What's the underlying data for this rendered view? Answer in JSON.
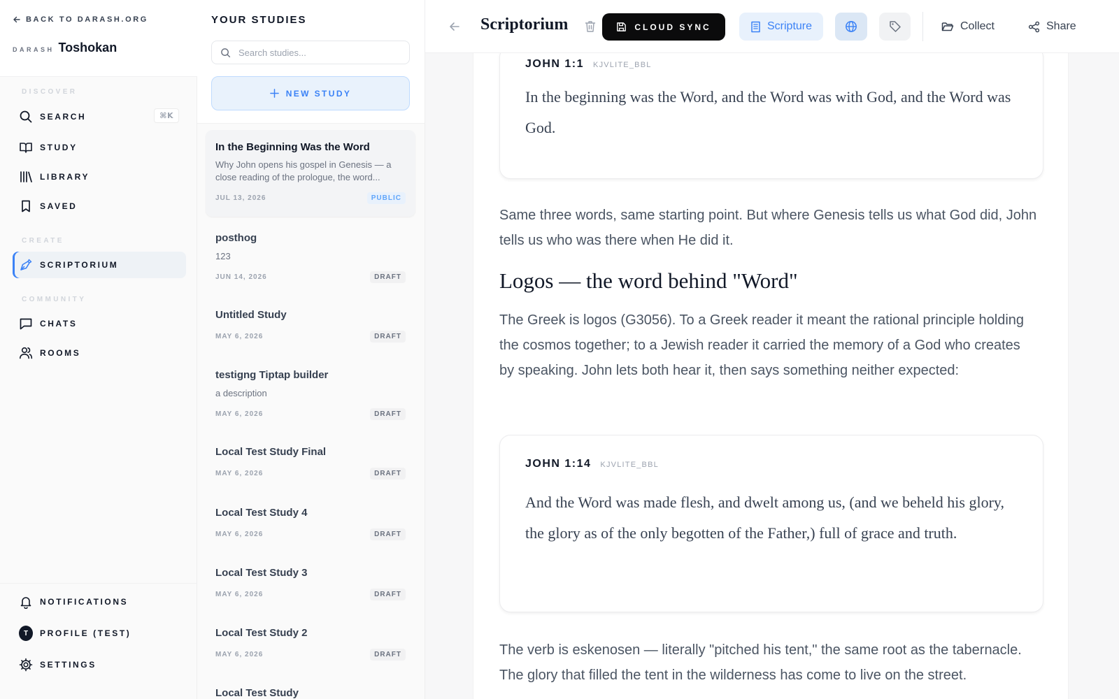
{
  "sidebar": {
    "back_label": "BACK TO DARASH.ORG",
    "brand_prefix": "DARASH",
    "brand_name": "Toshokan",
    "sections": {
      "discover": "DISCOVER",
      "create": "CREATE",
      "community": "COMMUNITY"
    },
    "items": {
      "search": "SEARCH",
      "search_shortcut": "⌘K",
      "study": "STUDY",
      "library": "LIBRARY",
      "saved": "SAVED",
      "scriptorium": "SCRIPTORIUM",
      "chats": "CHATS",
      "rooms": "ROOMS",
      "notifications": "NOTIFICATIONS",
      "profile": "PROFILE (TEST)",
      "profile_initial": "T",
      "settings": "SETTINGS"
    },
    "active_item": "scriptorium"
  },
  "studies": {
    "title": "YOUR STUDIES",
    "search_placeholder": "Search studies...",
    "new_study_label": "NEW STUDY",
    "items": [
      {
        "title": "In the Beginning Was the Word",
        "desc": "Why John opens his gospel in Genesis — a close reading of the prologue, the word...",
        "date": "JUL 13, 2026",
        "status": "PUBLIC"
      },
      {
        "title": "posthog",
        "desc": "123",
        "date": "JUN 14, 2026",
        "status": "DRAFT"
      },
      {
        "title": "Untitled Study",
        "desc": "",
        "date": "MAY 6, 2026",
        "status": "DRAFT"
      },
      {
        "title": "testigng Tiptap builder",
        "desc": "a description",
        "date": "MAY 6, 2026",
        "status": "DRAFT"
      },
      {
        "title": "Local Test Study Final",
        "desc": "",
        "date": "MAY 6, 2026",
        "status": "DRAFT"
      },
      {
        "title": "Local Test Study 4",
        "desc": "",
        "date": "MAY 6, 2026",
        "status": "DRAFT"
      },
      {
        "title": "Local Test Study 3",
        "desc": "",
        "date": "MAY 6, 2026",
        "status": "DRAFT"
      },
      {
        "title": "Local Test Study 2",
        "desc": "",
        "date": "MAY 6, 2026",
        "status": "DRAFT"
      },
      {
        "title": "Local Test Study",
        "desc": "",
        "date": "",
        "status": ""
      }
    ]
  },
  "toolbar": {
    "doc_title": "Scriptorium",
    "cloud_sync_label": "CLOUD SYNC",
    "scripture_label": "Scripture",
    "collect_label": "Collect",
    "share_label": "Share"
  },
  "content": {
    "verse1": {
      "ref": "JOHN 1:1",
      "translation": "KJVLITE_BBL",
      "text": "In the beginning was the Word, and the Word was with God, and the Word was God."
    },
    "para1": "Same three words, same starting point. But where Genesis tells us what God did, John tells us who was there when He did it.",
    "heading1": "Logos — the word behind \"Word\"",
    "para2": "The Greek is logos (G3056). To a Greek reader it meant the rational principle holding the cosmos together; to a Jewish reader it carried the memory of a God who creates by speaking. John lets both hear it, then says something neither expected:",
    "verse2": {
      "ref": "JOHN 1:14",
      "translation": "KJVLITE_BBL",
      "text": "And the Word was made flesh, and dwelt among us, (and we beheld his glory, the glory as of the only begotten of the Father,) full of grace and truth."
    },
    "para3": "The verb is eskenosen — literally \"pitched his tent,\" the same root as the tabernacle. The glory that filled the tent in the wilderness has come to live on the street."
  },
  "colors": {
    "accent": "#3b82f6",
    "accent_soft": "#e8f1fc",
    "cloud_sync_bg": "#0b0b0c"
  }
}
